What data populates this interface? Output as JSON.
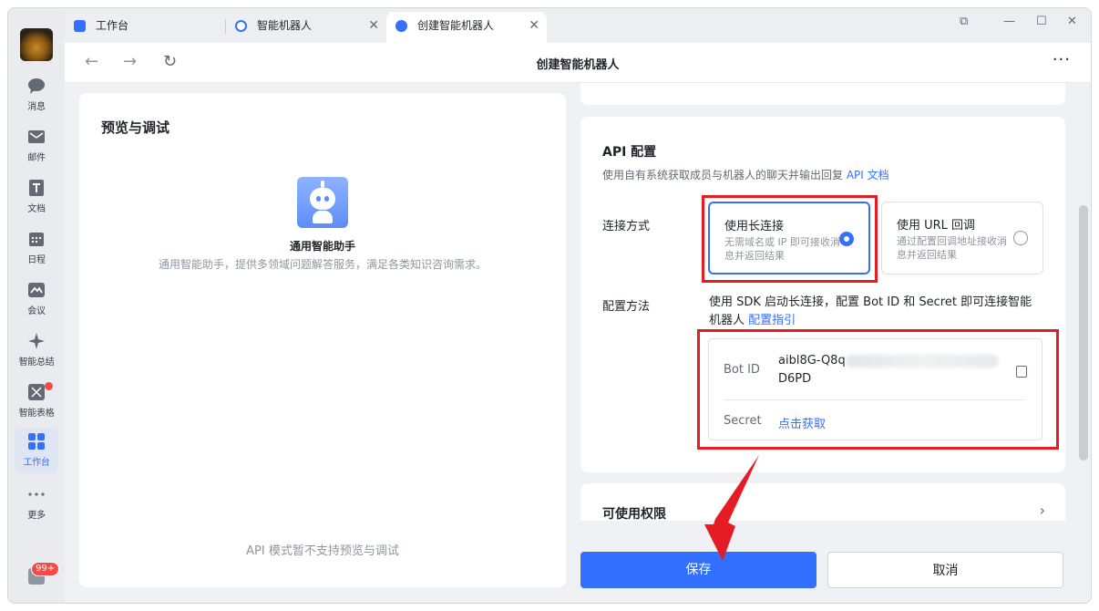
{
  "sidebar": {
    "items": [
      {
        "label": "消息",
        "icon": "chat-bubble-icon"
      },
      {
        "label": "邮件",
        "icon": "mail-icon"
      },
      {
        "label": "文档",
        "icon": "document-icon"
      },
      {
        "label": "日程",
        "icon": "calendar-icon"
      },
      {
        "label": "会议",
        "icon": "meeting-icon"
      },
      {
        "label": "智能总结",
        "icon": "sparkle-icon"
      },
      {
        "label": "智能表格",
        "icon": "smart-table-icon"
      },
      {
        "label": "工作台",
        "icon": "workspace-grid-icon"
      },
      {
        "label": "更多",
        "icon": "more-dots-icon"
      }
    ],
    "badge": "99+"
  },
  "tabs": [
    {
      "label": "工作台"
    },
    {
      "label": "智能机器人"
    },
    {
      "label": "创建智能机器人"
    }
  ],
  "topbar": {
    "title": "创建智能机器人"
  },
  "preview": {
    "title": "预览与调试",
    "robot_name": "通用智能助手",
    "robot_desc": "通用智能助手，提供多领域问题解答服务，满足各类知识咨询需求。",
    "footer": "API 模式暂不支持预览与调试"
  },
  "api": {
    "title": "API 配置",
    "desc": "使用自有系统获取成员与机器人的聊天并输出回复",
    "doc_link": "API 文档",
    "conn_label": "连接方式",
    "options": [
      {
        "title": "使用长连接",
        "desc": "无需域名或 IP 即可接收消息并返回结果",
        "selected": true
      },
      {
        "title": "使用 URL 回调",
        "desc": "通过配置回调地址接收消息并返回结果",
        "selected": false
      }
    ],
    "method_label": "配置方法",
    "method_desc": "使用 SDK 启动长连接，配置 Bot ID 和 Secret 即可连接智能机器人",
    "guide_link": "配置指引",
    "bot_id_label": "Bot ID",
    "bot_id_prefix": "aibl8G-Q8q",
    "bot_id_suffix": "D6PD",
    "secret_label": "Secret",
    "secret_link": "点击获取"
  },
  "permissions": {
    "title": "可使用权限"
  },
  "buttons": {
    "save": "保存",
    "cancel": "取消"
  },
  "colors": {
    "accent": "#3370ff",
    "annotation": "#e51c23"
  }
}
